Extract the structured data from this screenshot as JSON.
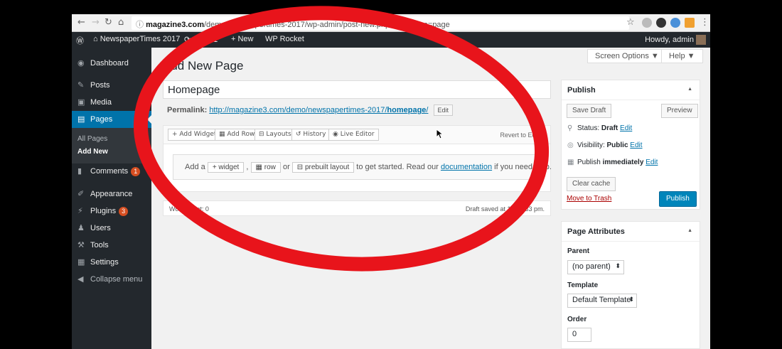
{
  "browser": {
    "url_host": "magazine3.com",
    "url_path": "/demo/newspapertimes-2017/wp-admin/post-new.php?post_type=page"
  },
  "adminbar": {
    "site_name": "NewspaperTimes 2017",
    "updates": "6",
    "comments": "1",
    "new_label": "New",
    "wp_rocket": "WP Rocket",
    "howdy": "Howdy, admin"
  },
  "sidebar": {
    "items": [
      {
        "label": "Dashboard"
      },
      {
        "label": "Posts"
      },
      {
        "label": "Media"
      },
      {
        "label": "Pages"
      },
      {
        "label": "Comments",
        "badge": "1"
      },
      {
        "label": "Appearance"
      },
      {
        "label": "Plugins",
        "badge": "3"
      },
      {
        "label": "Users"
      },
      {
        "label": "Tools"
      },
      {
        "label": "Settings"
      },
      {
        "label": "Collapse menu"
      }
    ],
    "submenu": [
      "All Pages",
      "Add New"
    ]
  },
  "screen_options": "Screen Options ▼",
  "help": "Help ▼",
  "page_title": "Add New Page",
  "title_value": "Homepage",
  "permalink": {
    "label": "Permalink:",
    "url_base": "http://magazine3.com/demo/newspapertimes-2017/",
    "slug": "homepage",
    "url_end": "/",
    "edit": "Edit"
  },
  "builder": {
    "toolbar": [
      "Add Widget",
      "Add Row",
      "Layouts",
      "History",
      "Live Editor"
    ],
    "revert": "Revert to Editor",
    "hint_add_a": "Add a",
    "hint_widget": "+ widget",
    "hint_comma": ",",
    "hint_row": "row",
    "hint_or": "or",
    "hint_layout": "prebuilt layout",
    "hint_text": "to get started. Read our",
    "hint_doc": "documentation",
    "hint_end": "if you need help."
  },
  "statusbar": {
    "word_count": "Word count: 0",
    "draft_saved": "Draft saved at 12:53:33 pm."
  },
  "publish": {
    "title": "Publish",
    "save_draft": "Save Draft",
    "preview": "Preview",
    "status_label": "Status:",
    "status_value": "Draft",
    "visibility_label": "Visibility:",
    "visibility_value": "Public",
    "publish_label": "Publish",
    "publish_value": "immediately",
    "edit": "Edit",
    "clear_cache": "Clear cache",
    "trash": "Move to Trash",
    "publish_button": "Publish"
  },
  "attributes": {
    "title": "Page Attributes",
    "parent_label": "Parent",
    "parent_value": "(no parent)",
    "template_label": "Template",
    "template_value": "Default Template",
    "order_label": "Order",
    "order_value": "0"
  },
  "colors": {
    "admin_dark": "#23282d",
    "accent": "#0073aa",
    "publish_blue": "#0085ba",
    "annotation_red": "#e8141b"
  }
}
